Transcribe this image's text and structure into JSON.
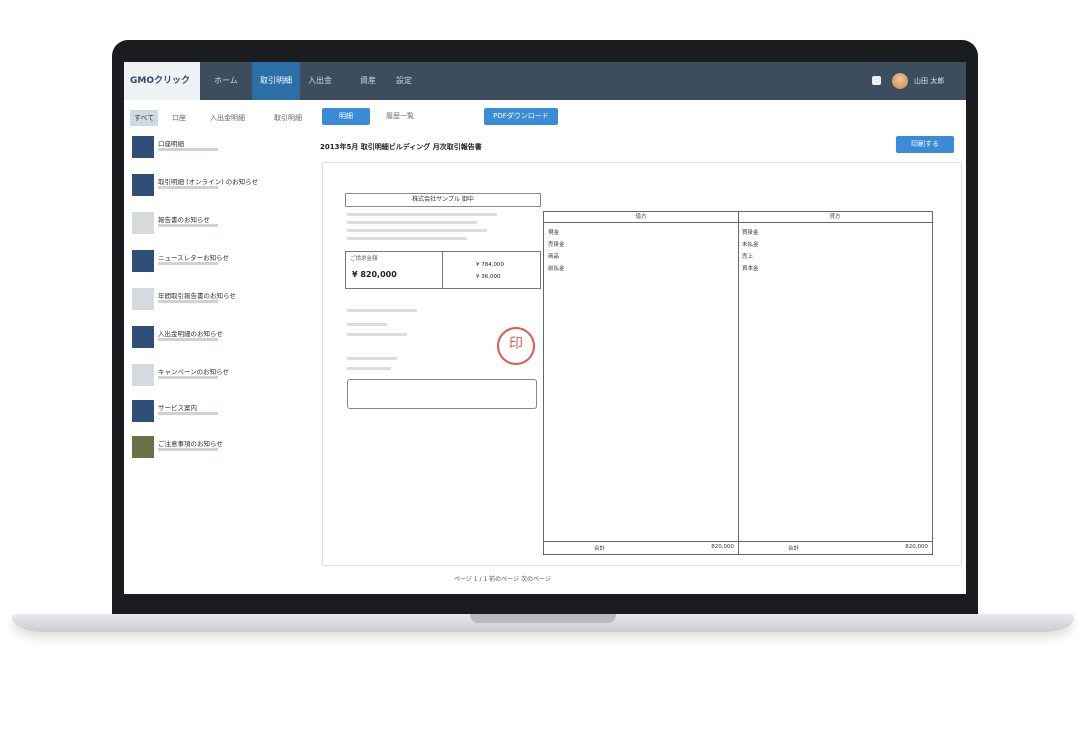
{
  "header": {
    "logo": "GMOクリック",
    "nav": [
      "ホーム",
      "取引明細",
      "入出金",
      "資産",
      "設定"
    ],
    "username": "山田 太郎"
  },
  "sidebar": {
    "tabs": [
      "すべて",
      "口座",
      "入出金明細",
      "取引明細"
    ],
    "items": [
      {
        "title": "口座明細"
      },
      {
        "title": "取引明細 (オンライン) のお知らせ"
      },
      {
        "title": "報告書のお知らせ"
      },
      {
        "title": "ニュースレターお知らせ"
      },
      {
        "title": "年間取引報告書のお知らせ"
      },
      {
        "title": "入出金明細のお知らせ"
      },
      {
        "title": "キャンペーンのお知らせ"
      },
      {
        "title": "サービス案内"
      },
      {
        "title": "ご注意事項のお知らせ"
      }
    ]
  },
  "main": {
    "tab_active": "明細",
    "tab_other": "履歴一覧",
    "action_button": "PDFダウンロード",
    "print_button": "印刷する",
    "doc_title": "2013年5月 取引明細ビルディング 月次取引報告書",
    "sheet": {
      "addr_label": "株式会社サンプル 御中",
      "amount_label": "ご請求金額",
      "amount_value": "¥ 820,000",
      "sub_amount_1": "¥ 784,000",
      "sub_amount_2": "¥ 36,000",
      "stamp_char": "印",
      "ledger_left_head": "借方",
      "ledger_right_head": "貸方",
      "left_rows": [
        "現金",
        "売掛金",
        "商品",
        "前払金"
      ],
      "right_rows": [
        "買掛金",
        "未払金",
        "売上",
        "資本金"
      ],
      "total_label": "合計",
      "total_value": "820,000"
    },
    "footer": "ページ 1 / 1 前のページ 次のページ"
  }
}
